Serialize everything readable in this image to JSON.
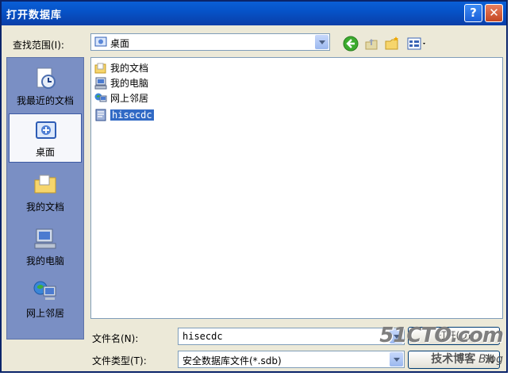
{
  "window": {
    "title": "打开数据库"
  },
  "titlebar_buttons": {
    "help": "?",
    "close": "✕"
  },
  "lookin": {
    "label": "查找范围(I):",
    "value": "桌面"
  },
  "places": [
    {
      "label": "我最近的文档",
      "icon": "recent-documents-icon"
    },
    {
      "label": "桌面",
      "icon": "desktop-icon",
      "selected": true
    },
    {
      "label": "我的文档",
      "icon": "my-documents-icon"
    },
    {
      "label": "我的电脑",
      "icon": "my-computer-icon"
    },
    {
      "label": "网上邻居",
      "icon": "network-places-icon"
    }
  ],
  "files": [
    {
      "name": "我的文档",
      "icon": "folder-icon"
    },
    {
      "name": "我的电脑",
      "icon": "computer-icon"
    },
    {
      "name": "网上邻居",
      "icon": "network-icon"
    },
    {
      "name": "hisecdc",
      "icon": "database-file-icon",
      "selected": true
    }
  ],
  "filename": {
    "label": "文件名(N):",
    "value": "hisecdc"
  },
  "filetype": {
    "label": "文件类型(T):",
    "value": "安全数据库文件(*.sdb)"
  },
  "buttons": {
    "open": "打开(O)",
    "cancel": "消"
  },
  "watermark": {
    "line1": "51CTO.com",
    "line2": "技术博客",
    "line3": "Blog"
  },
  "colors": {
    "title_bar": "#0653c8",
    "selection": "#316ac5",
    "places_bar": "#7a8fc4"
  }
}
